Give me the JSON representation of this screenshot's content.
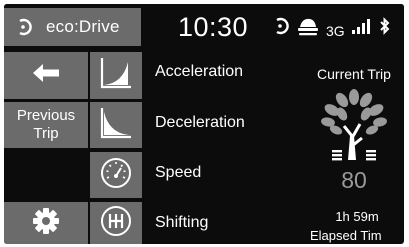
{
  "header": {
    "app_title": "eco:Drive",
    "time": "10:30",
    "network": "3G"
  },
  "nav": {
    "back_icon": "arrow-left-icon",
    "previous_trip_line1": "Previous",
    "previous_trip_line2": "Trip",
    "settings_icon": "gear-icon"
  },
  "rows": {
    "acceleration": "Acceleration",
    "deceleration": "Deceleration",
    "speed": "Speed",
    "shifting": "Shifting"
  },
  "panel": {
    "title": "Current Trip",
    "score": "80",
    "elapsed_value": "1h 59m",
    "elapsed_label": "Elapsed Tim"
  },
  "colors": {
    "background": "#0c0c0c",
    "button": "#6b6b6b",
    "score_text": "#9a9a9a"
  }
}
